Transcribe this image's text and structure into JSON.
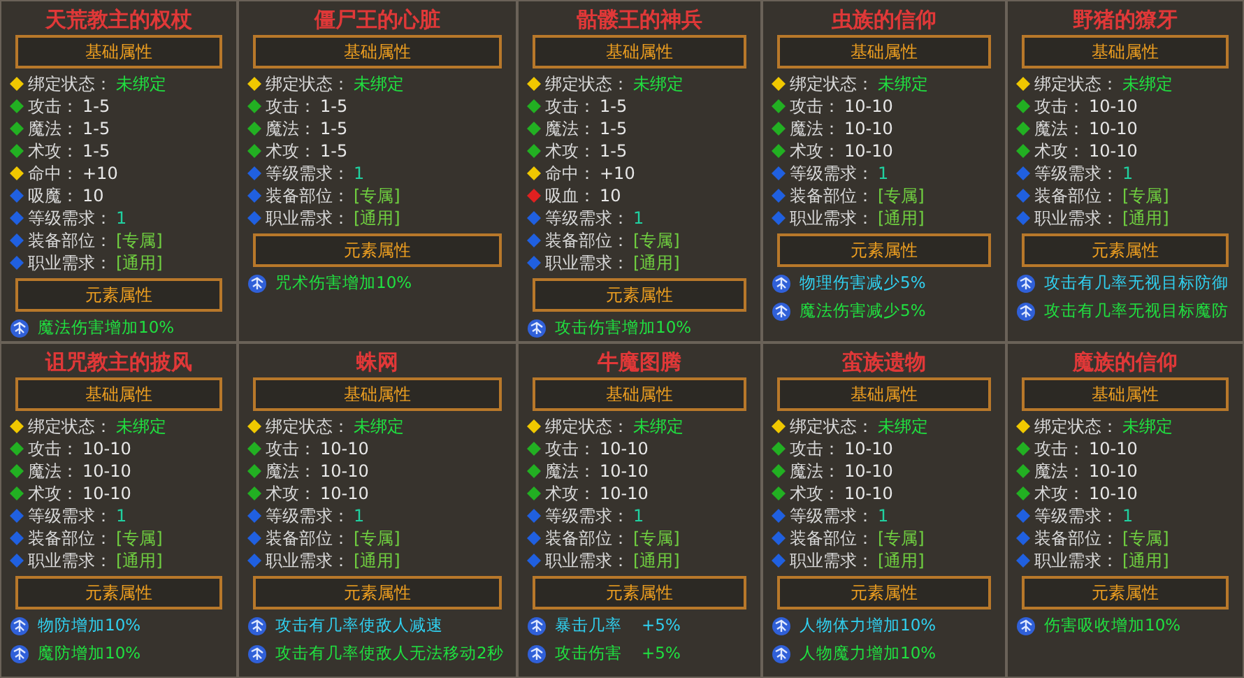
{
  "cards": [
    {
      "title": "天荒教主的权杖",
      "base_header": "基础属性",
      "element_header": "元素属性",
      "stats": [
        {
          "label": "绑定状态：",
          "value": "未绑定",
          "kind": "binding",
          "color": "#f0c800"
        },
        {
          "label": "攻击：",
          "value": "1-5",
          "kind": "number",
          "color": "#22b022"
        },
        {
          "label": "魔法：",
          "value": "1-5",
          "kind": "number",
          "color": "#22b022"
        },
        {
          "label": "术攻：",
          "value": "1-5",
          "kind": "number",
          "color": "#22b022"
        },
        {
          "label": "命中：",
          "value": "+10",
          "kind": "number",
          "color": "#f0c800"
        },
        {
          "label": "吸魔：",
          "value": "10",
          "kind": "number",
          "color": "#2060e0"
        },
        {
          "label": "等级需求：",
          "value": "1",
          "kind": "level",
          "color": "#2060e0"
        },
        {
          "label": "装备部位：",
          "value": "[专属]",
          "kind": "bracket",
          "color": "#2060e0"
        },
        {
          "label": "职业需求：",
          "value": "[通用]",
          "kind": "bracket",
          "color": "#2060e0"
        }
      ],
      "elements": [
        {
          "text": "魔法伤害增加10%",
          "color": "#20e040"
        }
      ]
    },
    {
      "title": "僵尸王的心脏",
      "base_header": "基础属性",
      "element_header": "元素属性",
      "stats": [
        {
          "label": "绑定状态：",
          "value": "未绑定",
          "kind": "binding",
          "color": "#f0c800"
        },
        {
          "label": "攻击：",
          "value": "1-5",
          "kind": "number",
          "color": "#22b022"
        },
        {
          "label": "魔法：",
          "value": "1-5",
          "kind": "number",
          "color": "#22b022"
        },
        {
          "label": "术攻：",
          "value": "1-5",
          "kind": "number",
          "color": "#22b022"
        },
        {
          "label": "等级需求：",
          "value": "1",
          "kind": "level",
          "color": "#2060e0"
        },
        {
          "label": "装备部位：",
          "value": "[专属]",
          "kind": "bracket",
          "color": "#2060e0"
        },
        {
          "label": "职业需求：",
          "value": "[通用]",
          "kind": "bracket",
          "color": "#2060e0"
        }
      ],
      "elements": [
        {
          "text": "咒术伤害增加10%",
          "color": "#20e040"
        }
      ]
    },
    {
      "title": "骷髅王的神兵",
      "base_header": "基础属性",
      "element_header": "元素属性",
      "stats": [
        {
          "label": "绑定状态：",
          "value": "未绑定",
          "kind": "binding",
          "color": "#f0c800"
        },
        {
          "label": "攻击：",
          "value": "1-5",
          "kind": "number",
          "color": "#22b022"
        },
        {
          "label": "魔法：",
          "value": "1-5",
          "kind": "number",
          "color": "#22b022"
        },
        {
          "label": "术攻：",
          "value": "1-5",
          "kind": "number",
          "color": "#22b022"
        },
        {
          "label": "命中：",
          "value": "+10",
          "kind": "number",
          "color": "#f0c800"
        },
        {
          "label": "吸血：",
          "value": "10",
          "kind": "number",
          "color": "#e02020"
        },
        {
          "label": "等级需求：",
          "value": "1",
          "kind": "level",
          "color": "#2060e0"
        },
        {
          "label": "装备部位：",
          "value": "[专属]",
          "kind": "bracket",
          "color": "#2060e0"
        },
        {
          "label": "职业需求：",
          "value": "[通用]",
          "kind": "bracket",
          "color": "#2060e0"
        }
      ],
      "elements": [
        {
          "text": "攻击伤害增加10%",
          "color": "#20e040"
        }
      ]
    },
    {
      "title": "虫族的信仰",
      "base_header": "基础属性",
      "element_header": "元素属性",
      "stats": [
        {
          "label": "绑定状态：",
          "value": "未绑定",
          "kind": "binding",
          "color": "#f0c800"
        },
        {
          "label": "攻击：",
          "value": "10-10",
          "kind": "number",
          "color": "#22b022"
        },
        {
          "label": "魔法：",
          "value": "10-10",
          "kind": "number",
          "color": "#22b022"
        },
        {
          "label": "术攻：",
          "value": "10-10",
          "kind": "number",
          "color": "#22b022"
        },
        {
          "label": "等级需求：",
          "value": "1",
          "kind": "level",
          "color": "#2060e0"
        },
        {
          "label": "装备部位：",
          "value": "[专属]",
          "kind": "bracket",
          "color": "#2060e0"
        },
        {
          "label": "职业需求：",
          "value": "[通用]",
          "kind": "bracket",
          "color": "#2060e0"
        }
      ],
      "elements": [
        {
          "text": "物理伤害减少5%",
          "color": "#30d0f0"
        },
        {
          "text": "魔法伤害减少5%",
          "color": "#20e040"
        }
      ]
    },
    {
      "title": "野猪的獠牙",
      "base_header": "基础属性",
      "element_header": "元素属性",
      "stats": [
        {
          "label": "绑定状态：",
          "value": "未绑定",
          "kind": "binding",
          "color": "#f0c800"
        },
        {
          "label": "攻击：",
          "value": "10-10",
          "kind": "number",
          "color": "#22b022"
        },
        {
          "label": "魔法：",
          "value": "10-10",
          "kind": "number",
          "color": "#22b022"
        },
        {
          "label": "术攻：",
          "value": "10-10",
          "kind": "number",
          "color": "#22b022"
        },
        {
          "label": "等级需求：",
          "value": "1",
          "kind": "level",
          "color": "#2060e0"
        },
        {
          "label": "装备部位：",
          "value": "[专属]",
          "kind": "bracket",
          "color": "#2060e0"
        },
        {
          "label": "职业需求：",
          "value": "[通用]",
          "kind": "bracket",
          "color": "#2060e0"
        }
      ],
      "elements": [
        {
          "text": "攻击有几率无视目标防御",
          "color": "#30d0f0"
        },
        {
          "text": "攻击有几率无视目标魔防",
          "color": "#20e040"
        }
      ]
    },
    {
      "title": "诅咒教主的披风",
      "base_header": "基础属性",
      "element_header": "元素属性",
      "stats": [
        {
          "label": "绑定状态：",
          "value": "未绑定",
          "kind": "binding",
          "color": "#f0c800"
        },
        {
          "label": "攻击：",
          "value": "10-10",
          "kind": "number",
          "color": "#22b022"
        },
        {
          "label": "魔法：",
          "value": "10-10",
          "kind": "number",
          "color": "#22b022"
        },
        {
          "label": "术攻：",
          "value": "10-10",
          "kind": "number",
          "color": "#22b022"
        },
        {
          "label": "等级需求：",
          "value": "1",
          "kind": "level",
          "color": "#2060e0"
        },
        {
          "label": "装备部位：",
          "value": "[专属]",
          "kind": "bracket",
          "color": "#2060e0"
        },
        {
          "label": "职业需求：",
          "value": "[通用]",
          "kind": "bracket",
          "color": "#2060e0"
        }
      ],
      "elements": [
        {
          "text": "物防增加10%",
          "color": "#30d0f0"
        },
        {
          "text": "魔防增加10%",
          "color": "#20e040"
        }
      ]
    },
    {
      "title": "蛛网",
      "base_header": "基础属性",
      "element_header": "元素属性",
      "stats": [
        {
          "label": "绑定状态：",
          "value": "未绑定",
          "kind": "binding",
          "color": "#f0c800"
        },
        {
          "label": "攻击：",
          "value": "10-10",
          "kind": "number",
          "color": "#22b022"
        },
        {
          "label": "魔法：",
          "value": "10-10",
          "kind": "number",
          "color": "#22b022"
        },
        {
          "label": "术攻：",
          "value": "10-10",
          "kind": "number",
          "color": "#22b022"
        },
        {
          "label": "等级需求：",
          "value": "1",
          "kind": "level",
          "color": "#2060e0"
        },
        {
          "label": "装备部位：",
          "value": "[专属]",
          "kind": "bracket",
          "color": "#2060e0"
        },
        {
          "label": "职业需求：",
          "value": "[通用]",
          "kind": "bracket",
          "color": "#2060e0"
        }
      ],
      "elements": [
        {
          "text": "攻击有几率使敌人减速",
          "color": "#30d0f0"
        },
        {
          "text": "攻击有几率使敌人无法移动2秒",
          "color": "#20e040"
        }
      ]
    },
    {
      "title": "牛魔图腾",
      "base_header": "基础属性",
      "element_header": "元素属性",
      "stats": [
        {
          "label": "绑定状态：",
          "value": "未绑定",
          "kind": "binding",
          "color": "#f0c800"
        },
        {
          "label": "攻击：",
          "value": "10-10",
          "kind": "number",
          "color": "#22b022"
        },
        {
          "label": "魔法：",
          "value": "10-10",
          "kind": "number",
          "color": "#22b022"
        },
        {
          "label": "术攻：",
          "value": "10-10",
          "kind": "number",
          "color": "#22b022"
        },
        {
          "label": "等级需求：",
          "value": "1",
          "kind": "level",
          "color": "#2060e0"
        },
        {
          "label": "装备部位：",
          "value": "[专属]",
          "kind": "bracket",
          "color": "#2060e0"
        },
        {
          "label": "职业需求：",
          "value": "[通用]",
          "kind": "bracket",
          "color": "#2060e0"
        }
      ],
      "elements": [
        {
          "text": "暴击几率",
          "value": "+5%",
          "color": "#30d0f0"
        },
        {
          "text": "攻击伤害",
          "value": "+5%",
          "color": "#20e040"
        }
      ]
    },
    {
      "title": "蛮族遗物",
      "base_header": "基础属性",
      "element_header": "元素属性",
      "stats": [
        {
          "label": "绑定状态：",
          "value": "未绑定",
          "kind": "binding",
          "color": "#f0c800"
        },
        {
          "label": "攻击：",
          "value": "10-10",
          "kind": "number",
          "color": "#22b022"
        },
        {
          "label": "魔法：",
          "value": "10-10",
          "kind": "number",
          "color": "#22b022"
        },
        {
          "label": "术攻：",
          "value": "10-10",
          "kind": "number",
          "color": "#22b022"
        },
        {
          "label": "等级需求：",
          "value": "1",
          "kind": "level",
          "color": "#2060e0"
        },
        {
          "label": "装备部位：",
          "value": "[专属]",
          "kind": "bracket",
          "color": "#2060e0"
        },
        {
          "label": "职业需求：",
          "value": "[通用]",
          "kind": "bracket",
          "color": "#2060e0"
        }
      ],
      "elements": [
        {
          "text": "人物体力增加10%",
          "color": "#30d0f0"
        },
        {
          "text": "人物魔力增加10%",
          "color": "#20e040"
        }
      ]
    },
    {
      "title": "魔族的信仰",
      "base_header": "基础属性",
      "element_header": "元素属性",
      "stats": [
        {
          "label": "绑定状态：",
          "value": "未绑定",
          "kind": "binding",
          "color": "#f0c800"
        },
        {
          "label": "攻击：",
          "value": "10-10",
          "kind": "number",
          "color": "#22b022"
        },
        {
          "label": "魔法：",
          "value": "10-10",
          "kind": "number",
          "color": "#22b022"
        },
        {
          "label": "术攻：",
          "value": "10-10",
          "kind": "number",
          "color": "#22b022"
        },
        {
          "label": "等级需求：",
          "value": "1",
          "kind": "level",
          "color": "#2060e0"
        },
        {
          "label": "装备部位：",
          "value": "[专属]",
          "kind": "bracket",
          "color": "#2060e0"
        },
        {
          "label": "职业需求：",
          "value": "[通用]",
          "kind": "bracket",
          "color": "#2060e0"
        }
      ],
      "elements": [
        {
          "text": "伤害吸收增加10%",
          "color": "#20e040"
        }
      ]
    }
  ]
}
